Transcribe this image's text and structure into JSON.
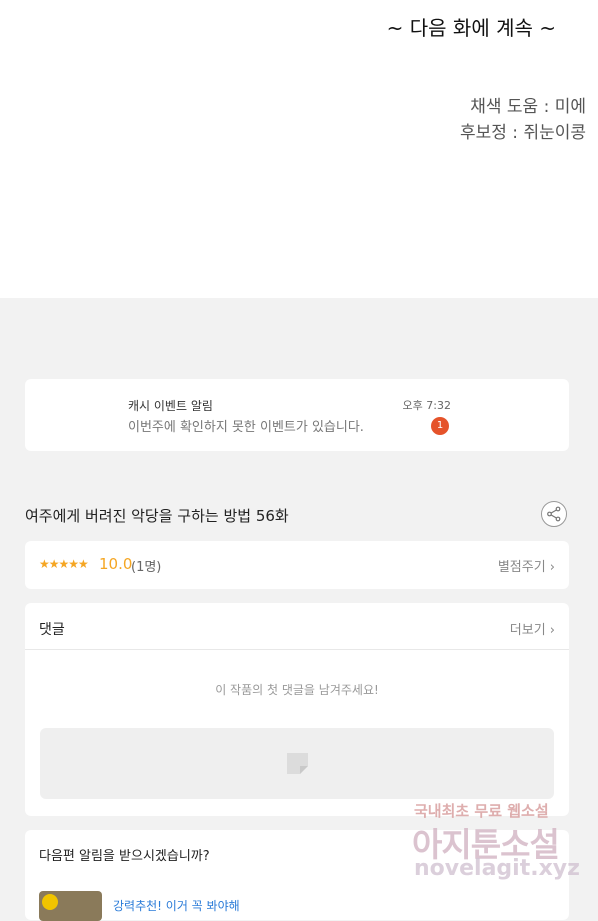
{
  "viewer": {
    "next_episode": "~ 다음 화에 계속 ~",
    "credits": [
      "채색 도움 : 미에",
      "후보정 : 쥐눈이콩"
    ]
  },
  "notification": {
    "title": "캐시 이벤트 알림",
    "body": "이번주에 확인하지 못한 이벤트가 있습니다.",
    "time": "오후 7:32",
    "badge": "1"
  },
  "episode": {
    "title": "여주에게 버려진 악당을 구하는 방법 56화"
  },
  "rating": {
    "stars": "★★★★★",
    "score": "10.0",
    "count": "(1명)",
    "rate_link": "별점주기 ›"
  },
  "comments": {
    "header": "댓글",
    "more_link": "더보기 ›",
    "empty_message": "이 작품의 첫 댓글을 남겨주세요!"
  },
  "subscribe": {
    "question": "다음편 알림을 받으시겠습니까?",
    "recommendation": "강력추천! 이거 꼭 봐야해"
  },
  "watermark": {
    "line1": "국내최초 무료 웹소설",
    "line2": "아지툰소설",
    "line3": "novelagit.xyz"
  },
  "colors": {
    "accent_star": "#f5a623",
    "badge": "#e5532a",
    "link": "#2a7bd8"
  }
}
